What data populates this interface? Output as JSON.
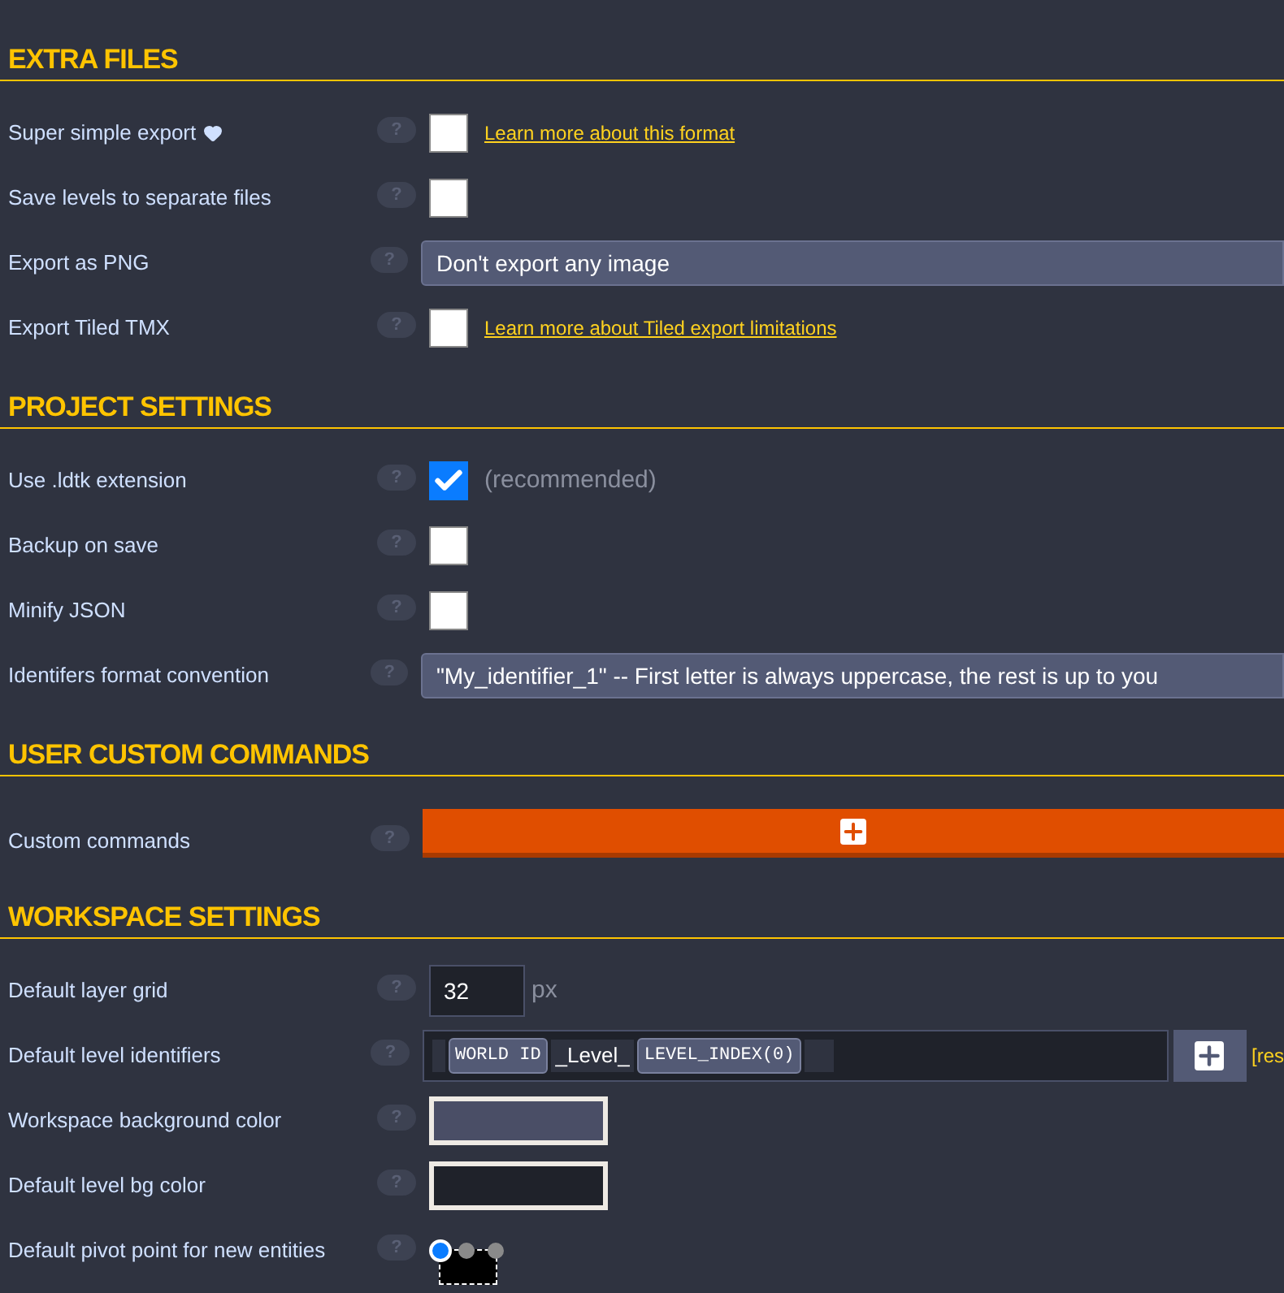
{
  "sections": [
    {
      "title": "EXTRA FILES",
      "rows": [
        {
          "kind": "checkbox",
          "label": "Super simple export",
          "heart": true,
          "help": "?",
          "checked": false,
          "link": "Learn more about this format"
        },
        {
          "kind": "checkbox",
          "label": "Save levels to separate files",
          "help": "?",
          "checked": false
        },
        {
          "kind": "select",
          "label": "Export as PNG",
          "help": "?",
          "value": "Don't export any image"
        },
        {
          "kind": "checkbox",
          "label": "Export Tiled TMX",
          "help": "?",
          "checked": false,
          "link": "Learn more about Tiled export limitations"
        }
      ]
    },
    {
      "title": "PROJECT SETTINGS",
      "rows": [
        {
          "kind": "checkbox",
          "label": "Use .ldtk extension",
          "help": "?",
          "checked": true,
          "note": "(recommended)"
        },
        {
          "kind": "checkbox",
          "label": "Backup on save",
          "help": "?",
          "checked": false
        },
        {
          "kind": "checkbox",
          "label": "Minify JSON",
          "help": "?",
          "checked": false
        },
        {
          "kind": "select",
          "label": "Identifers format convention",
          "help": "?",
          "value": "\"My_identifier_1\" -- First letter is always uppercase, the rest is up to you"
        }
      ]
    },
    {
      "title": "USER CUSTOM COMMANDS",
      "rows": [
        {
          "kind": "add",
          "label": "Custom commands",
          "help": "?"
        }
      ]
    },
    {
      "title": "WORKSPACE SETTINGS",
      "rows": [
        {
          "kind": "number",
          "label": "Default layer grid",
          "help": "?",
          "value": "32",
          "unit": "px"
        },
        {
          "kind": "identifier",
          "label": "Default level identifiers",
          "help": "?",
          "parts": [
            {
              "kind": "token",
              "text": "WORLD ID"
            },
            {
              "kind": "text",
              "text": "_Level_"
            },
            {
              "kind": "token",
              "text": "LEVEL_INDEX(0)"
            }
          ],
          "reset": "[res"
        },
        {
          "kind": "color",
          "label": "Workspace background color",
          "help": "?",
          "color": "#4a4e66"
        },
        {
          "kind": "color",
          "label": "Default level bg color",
          "help": "?",
          "color": "#1f222a"
        },
        {
          "kind": "pivot",
          "label": "Default pivot point for new entities",
          "help": "?",
          "points": [
            {
              "selected": true
            },
            {
              "selected": false
            },
            {
              "selected": false
            }
          ]
        }
      ]
    }
  ]
}
